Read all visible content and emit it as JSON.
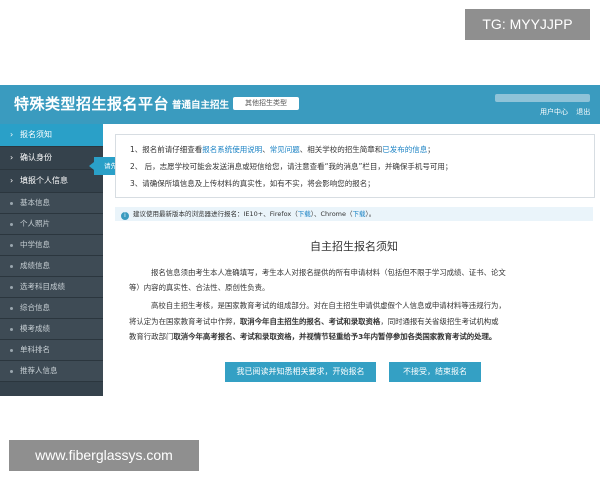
{
  "watermarks": {
    "top": "TG: MYYJJPP",
    "bottom": "www.fiberglassys.com"
  },
  "header": {
    "title": "特殊类型招生报名平台",
    "subtitle": "普通自主招生",
    "type_dropdown": "其他招生类型",
    "links": [
      "用户中心",
      "退出"
    ]
  },
  "sidebar": {
    "main_items": [
      {
        "label": "报名须知",
        "active": true
      },
      {
        "label": "确认身份",
        "active": false
      },
      {
        "label": "填报个人信息",
        "active": false
      }
    ],
    "tooltip": "请先阅读报名须知",
    "sub_items": [
      "基本信息",
      "个人照片",
      "中学信息",
      "成绩信息",
      "选考科目成绩",
      "综合信息",
      "模考成绩",
      "单科排名",
      "推荐人信息"
    ]
  },
  "notice": {
    "line1_prefix": "1、报名前请仔细查看",
    "link_usage": "报名系统使用说明",
    "sep": "、",
    "link_faq": "常见问题",
    "line1_mid": "、相关学校的招生简章和",
    "link_published": "已发布的信息",
    "line1_suffix": "；",
    "line2": "2、 后，志愿学校可能会发送消息或短信给您，请注意查看“我的消息”栏目，并确保手机号可用；",
    "line3": "3、请确保所填信息及上传材料的真实性，如有不实，将会影响您的报名；"
  },
  "browser_tip": {
    "icon": "info-icon",
    "text_prefix": "建议使用最新版本的浏览器进行报名：IE10+、Firefox（",
    "download1": "下载",
    "text_mid": "）、Chrome（",
    "download2": "下载",
    "text_suffix": "）。"
  },
  "instructions": {
    "title": "自主招生报名须知",
    "para1_line1": "报名信息须由考生本人准确填写，考生本人对报名提供的所有申请材料（包括但不限于学习成绩、证书、论文",
    "para1_line2": "等）内容的真实性、合法性、原创性负责。",
    "para2_line1": "高校自主招生考核，是国家教育考试的组成部分。对在自主招生申请供虚假个人信息或申请材料等违规行为，",
    "para2_line2_normal": "将认定为在国家教育考试中作弊，",
    "para2_line2_bold": "取消今年自主招生的报名、考试和录取资格",
    "para2_line2_tail": "，同时通报有关省级招生考试机构或",
    "para2_line3_normal": "教育行政部门",
    "para2_line3_bold": "取消今年高考报名、考试和录取资格，并视情节轻重给予3年内暂停参加各类国家教育考试的处理。"
  },
  "buttons": {
    "agree": "我已阅读并知悉相关要求，开始报名",
    "disagree": "不接受，结束报名"
  },
  "colors": {
    "header": "#3a9bbf",
    "sidebar": "#35424c",
    "active": "#2aa0c8",
    "button": "#34a0c4",
    "link": "#1a82c4"
  }
}
